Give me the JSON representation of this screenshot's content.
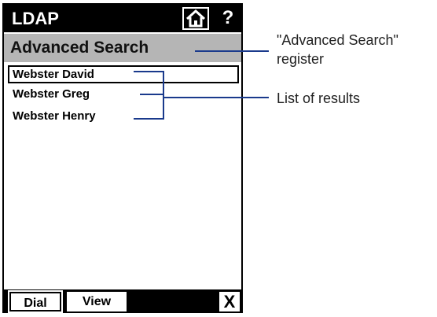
{
  "app": {
    "title": "LDAP",
    "help_label": "?"
  },
  "register": {
    "label": "Advanced Search"
  },
  "results": [
    {
      "name": "Webster David",
      "selected": true
    },
    {
      "name": "Webster Greg",
      "selected": false
    },
    {
      "name": "Webster Henry",
      "selected": false
    }
  ],
  "softkeys": {
    "dial": "Dial",
    "view": "View",
    "close": "X"
  },
  "callouts": {
    "register_line1": "\"Advanced Search\"",
    "register_line2": "register",
    "results": "List of results"
  },
  "icons": {
    "home": "home-icon",
    "help": "help-icon",
    "close": "close-icon"
  },
  "colors": {
    "bar": "#000000",
    "register_bg": "#b5b5b5",
    "callout_line": "#1a3a8c"
  }
}
